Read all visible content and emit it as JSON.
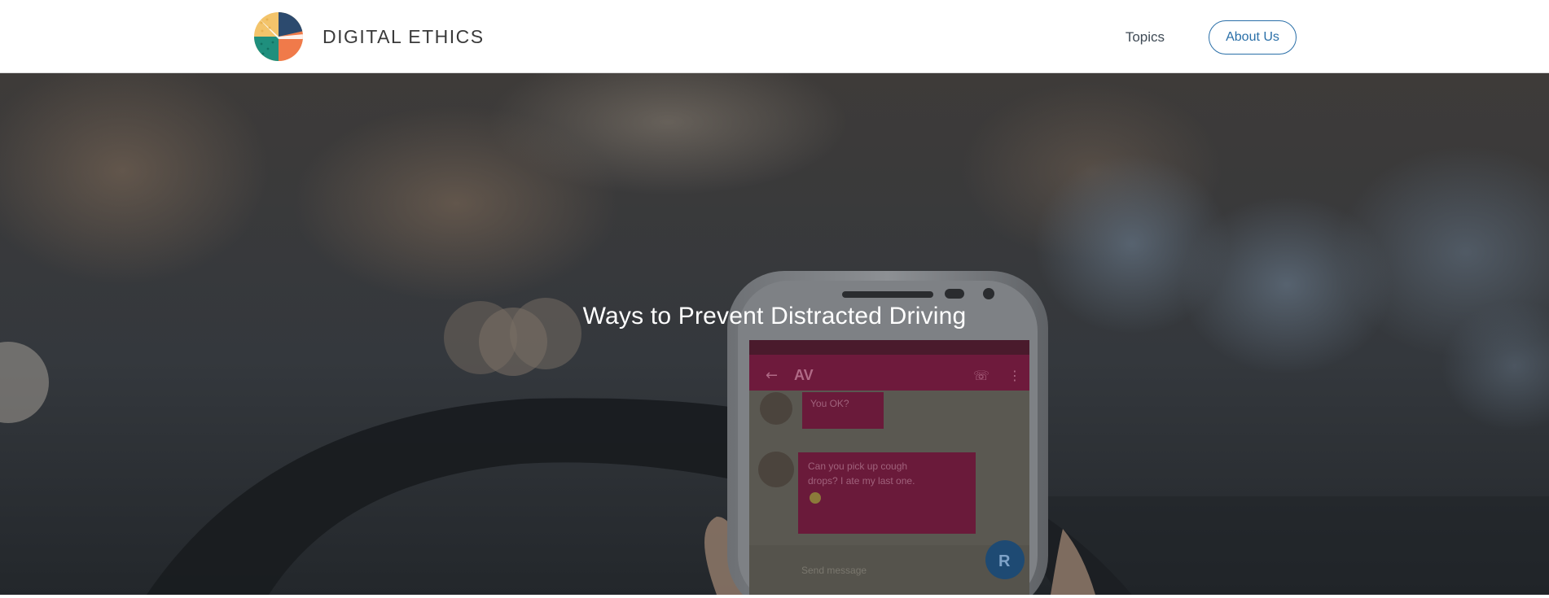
{
  "header": {
    "brand_name": "DIGITAL ETHICS",
    "logo_icon": "globe-logo-icon",
    "nav": {
      "topics_label": "Topics",
      "about_label": "About Us"
    }
  },
  "hero": {
    "title": "Ways to Prevent Distracted Driving",
    "image_subject": "hand holding smartphone with text messages behind steering wheel",
    "phone_screen": {
      "contact": "AV",
      "messages": [
        "You OK?",
        "Can you pick up cough drops? I ate my last one."
      ],
      "compose_placeholder": "Send message",
      "avatar_letter": "R"
    }
  },
  "colors": {
    "header_bg": "#ffffff",
    "brand_text": "#3a3a3a",
    "nav_text": "#3f4a55",
    "accent": "#2a6fa8",
    "hero_text": "#ffffff",
    "phone_accent": "#c2185b"
  }
}
